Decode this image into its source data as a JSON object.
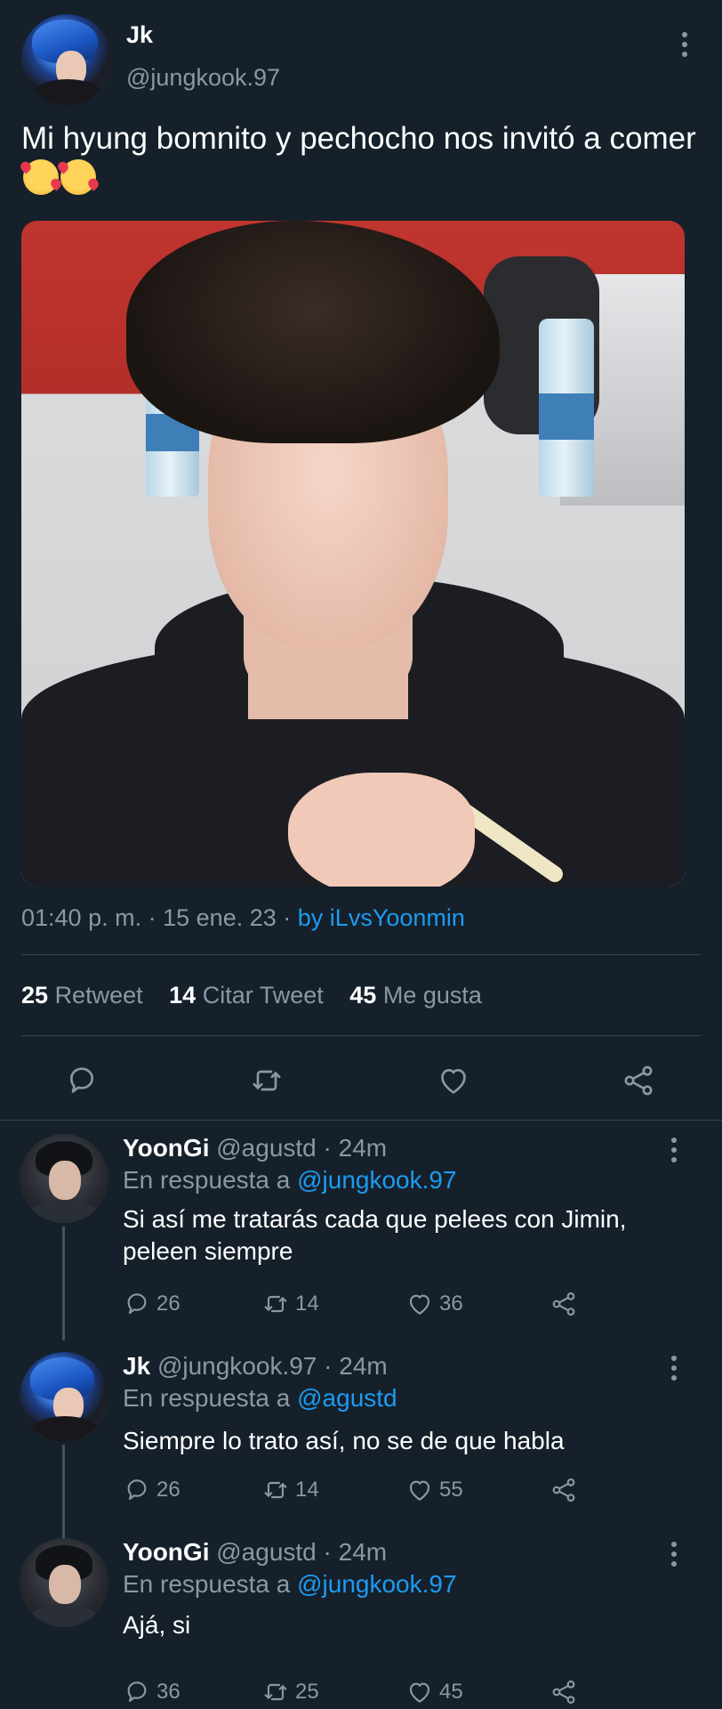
{
  "tweet": {
    "author": {
      "name": "Jk",
      "handle": "@jungkook.97"
    },
    "text": "Mi hyung bomnito y pechocho nos invitó a comer",
    "emoji": "smiling-face-with-hearts-emoji",
    "meta": {
      "time": "01:40 p. m.",
      "date": "15 ene. 23",
      "separator": "·",
      "source": "by iLvsYoonmin"
    },
    "stats": {
      "retweets": "25",
      "retweets_label": "Retweet",
      "quotes": "14",
      "quotes_label": "Citar Tweet",
      "likes": "45",
      "likes_label": "Me gusta"
    },
    "actions": [
      "reply-icon",
      "retweet-icon",
      "like-icon",
      "share-icon"
    ]
  },
  "replies": [
    {
      "name": "YoonGi",
      "handle": "@agustd",
      "separator": "·",
      "time": "24m",
      "reply_to_label": "En respuesta a",
      "reply_to": "@jungkook.97",
      "text": "Si así me tratarás cada que pelees con Jimin, peleen siempre",
      "replies": "26",
      "retweets": "14",
      "likes": "36"
    },
    {
      "name": "Jk",
      "handle": "@jungkook.97",
      "separator": "·",
      "time": "24m",
      "reply_to_label": "En respuesta a",
      "reply_to": "@agustd",
      "text": "Siempre lo trato así, no se de que habla",
      "replies": "26",
      "retweets": "14",
      "likes": "55"
    },
    {
      "name": "YoonGi",
      "handle": "@agustd",
      "separator": "·",
      "time": "24m",
      "reply_to_label": "En respuesta a",
      "reply_to": "@jungkook.97",
      "text": "Ajá, si",
      "replies": "36",
      "retweets": "25",
      "likes": "45"
    }
  ],
  "colors": {
    "background": "#15202b",
    "text": "#ffffff",
    "secondary": "#8899a6",
    "link": "#1d9bf0",
    "divider": "#38444d"
  }
}
